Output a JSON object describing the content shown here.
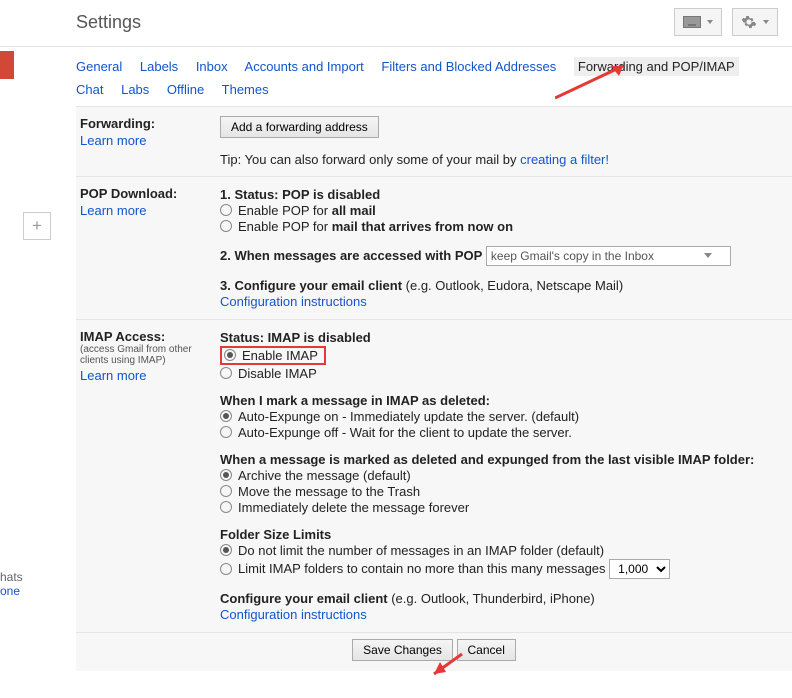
{
  "header": {
    "title": "Settings"
  },
  "leftRail": {
    "plus": "+",
    "chats": "hats",
    "one": "one"
  },
  "tabs": {
    "general": "General",
    "labels": "Labels",
    "inbox": "Inbox",
    "accounts": "Accounts and Import",
    "filters": "Filters and Blocked Addresses",
    "forwarding": "Forwarding and POP/IMAP",
    "chat": "Chat",
    "labs": "Labs",
    "offline": "Offline",
    "themes": "Themes"
  },
  "fwd": {
    "title": "Forwarding:",
    "learn": "Learn more",
    "addBtn": "Add a forwarding address",
    "tipA": "Tip: You can also forward only some of your mail by ",
    "tipB": "creating a filter!"
  },
  "pop": {
    "title": "POP Download:",
    "learn": "Learn more",
    "s1a": "1. Status: POP is disabled",
    "r1a": "Enable POP for ",
    "r1b": "all mail",
    "r2a": "Enable POP for ",
    "r2b": "mail that arrives from now on",
    "s2": "2. When messages are accessed with POP",
    "dd": "keep Gmail's copy in the Inbox",
    "s3a": "3. Configure your email client",
    "s3b": " (e.g. Outlook, Eudora, Netscape Mail)",
    "ci": "Configuration instructions"
  },
  "imap": {
    "title": "IMAP Access:",
    "sub": "(access Gmail from other clients using IMAP)",
    "learn": "Learn more",
    "status": "Status: IMAP is disabled",
    "enable": "Enable IMAP",
    "disable": "Disable IMAP",
    "markHdr": "When I mark a message in IMAP as deleted:",
    "ae_on": "Auto-Expunge on - Immediately update the server. (default)",
    "ae_off": "Auto-Expunge off - Wait for the client to update the server.",
    "expungeHdr": "When a message is marked as deleted and expunged from the last visible IMAP folder:",
    "arch": "Archive the message (default)",
    "trash": "Move the message to the Trash",
    "del": "Immediately delete the message forever",
    "folderHdr": "Folder Size Limits",
    "noLimit": "Do not limit the number of messages in an IMAP folder (default)",
    "limit": "Limit IMAP folders to contain no more than this many messages",
    "limitVal": "1,000",
    "cfgA": "Configure your email client",
    "cfgB": " (e.g. Outlook, Thunderbird, iPhone)",
    "ci": "Configuration instructions"
  },
  "footer": {
    "save": "Save Changes",
    "cancel": "Cancel"
  }
}
